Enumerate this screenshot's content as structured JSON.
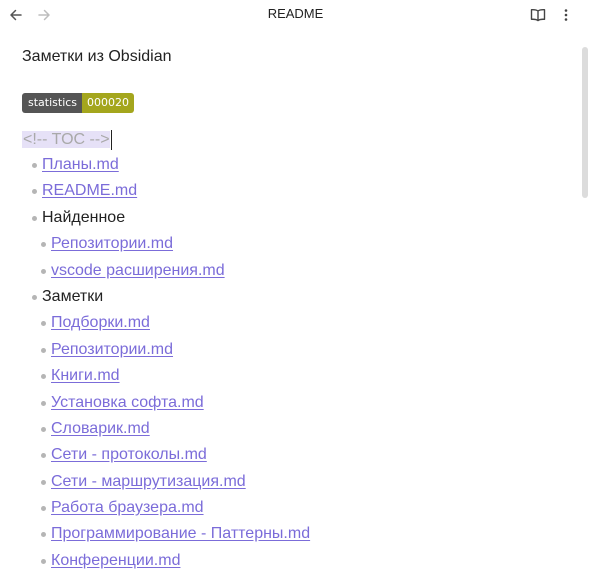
{
  "header": {
    "title": "README",
    "back_icon": "arrow-left-icon",
    "forward_icon": "arrow-right-icon",
    "reading_icon": "book-open-icon",
    "more_icon": "more-vertical-icon"
  },
  "document": {
    "heading": "Заметки из Obsidian",
    "badge": {
      "label": "statistics",
      "value": "000020",
      "label_color": "#555555",
      "value_color": "#a4a61d"
    },
    "toc_comment": "<!-- TOC -->",
    "items": [
      {
        "type": "link",
        "text": "Планы.md"
      },
      {
        "type": "link",
        "text": "README.md"
      },
      {
        "type": "folder",
        "text": "Найденное",
        "children": [
          {
            "type": "link",
            "text": "Репозитории.md"
          },
          {
            "type": "link",
            "text": "vscode расширения.md"
          }
        ]
      },
      {
        "type": "folder",
        "text": "Заметки",
        "children": [
          {
            "type": "link",
            "text": "Подборки.md"
          },
          {
            "type": "link",
            "text": "Репозитории.md"
          },
          {
            "type": "link",
            "text": "Книги.md"
          },
          {
            "type": "link",
            "text": "Установка софта.md"
          },
          {
            "type": "link",
            "text": "Словарик.md"
          },
          {
            "type": "link",
            "text": "Сети - протоколы.md"
          },
          {
            "type": "link",
            "text": "Сети - маршрутизация.md"
          },
          {
            "type": "link",
            "text": "Работа браузера.md"
          },
          {
            "type": "link",
            "text": "Программирование - Паттерны.md"
          },
          {
            "type": "link",
            "text": "Конференции.md"
          }
        ]
      }
    ]
  },
  "colors": {
    "link": "#7b6cd9",
    "text": "#222222",
    "comment_bg": "#e6e1f7",
    "comment_text": "#a9a9a9"
  }
}
